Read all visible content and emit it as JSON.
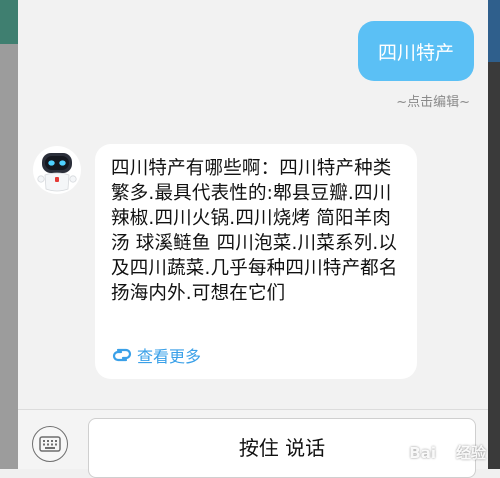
{
  "user_message": {
    "text": "四川特产",
    "edit_hint": "~点击编辑~"
  },
  "bot_message": {
    "text": "四川特产有哪些啊：四川特产种类繁多.最具代表性的:郫县豆瓣.四川辣椒.四川火锅.四川烧烤 简阳羊肉汤 球溪鲢鱼 四川泡菜.川菜系列.以及四川蔬菜.几乎每种四川特产都名扬海内外.可想在它们",
    "see_more": "查看更多"
  },
  "input_bar": {
    "talk_label": "按住 说话",
    "keyboard_icon": "keyboard-icon"
  },
  "watermark": {
    "brand_left": "Bai",
    "brand_right": "经验"
  },
  "colors": {
    "user_bubble": "#5bc0f5",
    "link": "#3aa0e8",
    "background": "#f2f2f2"
  }
}
